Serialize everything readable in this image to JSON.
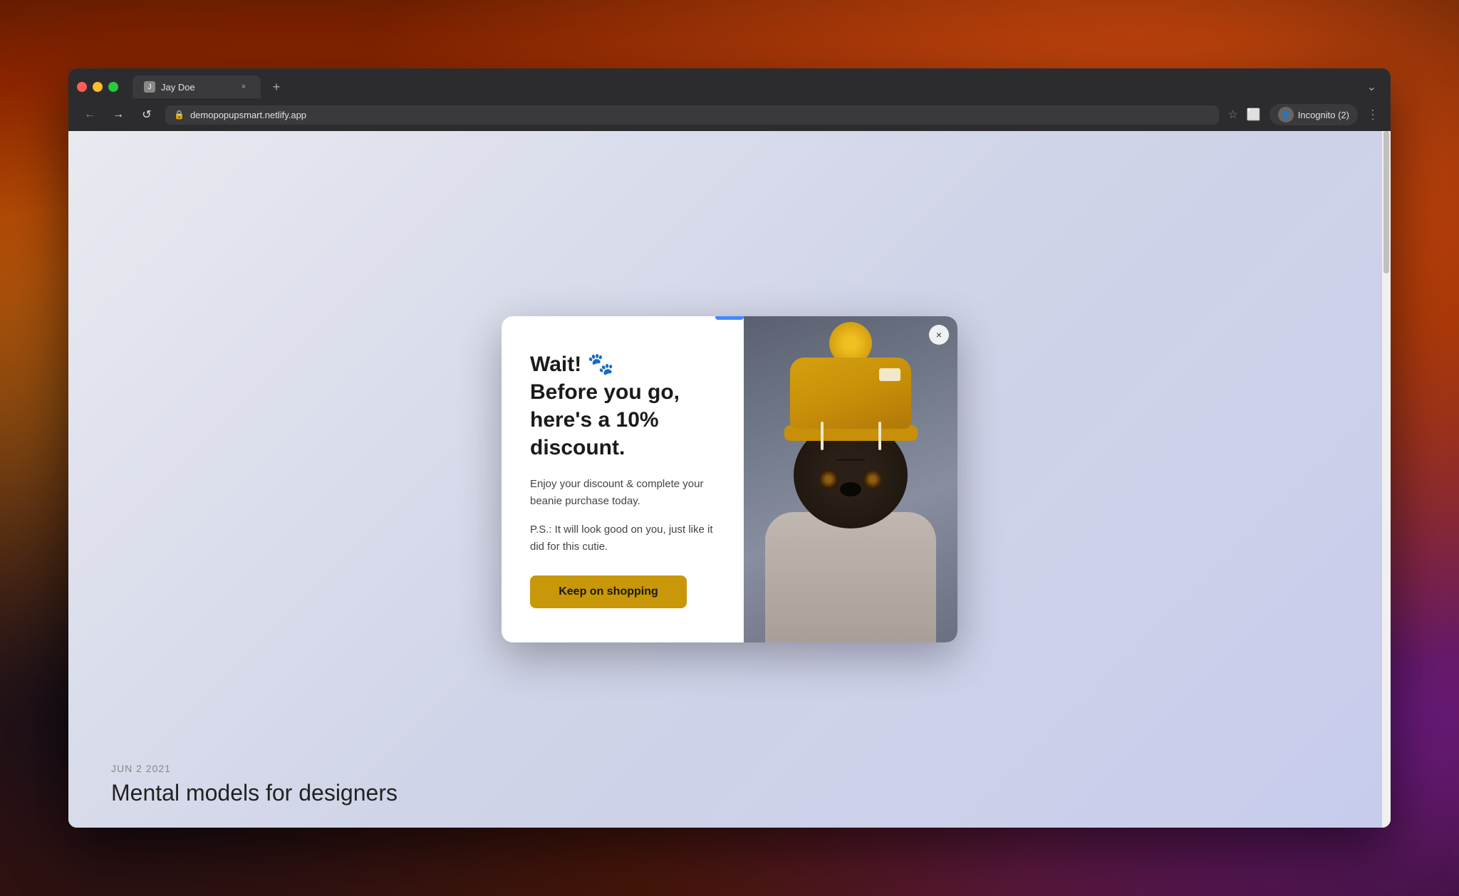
{
  "desktop": {
    "title": "macOS Desktop"
  },
  "browser": {
    "tab": {
      "title": "Jay Doe",
      "favicon_label": "J"
    },
    "tab_new_label": "+",
    "tab_dropdown_label": "⌄",
    "nav": {
      "back_label": "←",
      "forward_label": "→",
      "reload_label": "↺"
    },
    "url": "demopopupsmart.netlify.app",
    "lock_icon": "🔒",
    "bookmark_icon": "☆",
    "tab_icon": "⬜",
    "incognito_label": "Incognito (2)",
    "menu_icon": "⋮"
  },
  "page": {
    "date": "JUN 2 2021",
    "article_title": "Mental models for designers"
  },
  "modal": {
    "headline_line1": "Wait! 🐾",
    "headline_line2": "Before you go,",
    "headline_line3": "here's a 10%",
    "headline_line4": "discount.",
    "body_text": "Enjoy your discount & complete your beanie purchase today.",
    "ps_text": "P.S.: It will look good on you, just like it did for this cutie.",
    "cta_label": "Keep on shopping",
    "close_label": "×"
  }
}
